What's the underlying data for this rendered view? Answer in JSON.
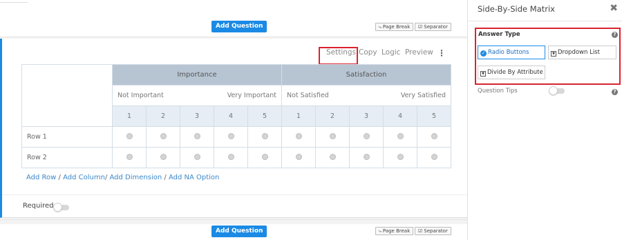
{
  "toolbar_buttons": {
    "add_question": "Add Question",
    "page_break": "Page Break",
    "separator": "Separator"
  },
  "question": {
    "actions": {
      "settings": "Settings",
      "copy": "Copy",
      "logic": "Logic",
      "preview": "Preview",
      "more": "⋮"
    },
    "dimensions": [
      "Importance",
      "Satisfaction"
    ],
    "scale_labels": {
      "importance_low": "Not Important",
      "importance_high": "Very Important",
      "satisfaction_low": "Not Satisfied",
      "satisfaction_high": "Very Satisfied"
    },
    "columns": [
      "1",
      "2",
      "3",
      "4",
      "5",
      "1",
      "2",
      "3",
      "4",
      "5"
    ],
    "rows": [
      "Row 1",
      "Row 2"
    ],
    "add_links": {
      "add_row": "Add Row",
      "add_column": "Add Column",
      "add_dimension": "Add Dimension",
      "add_na": "Add NA Option"
    },
    "required_label": "Required",
    "required_on": false
  },
  "panel": {
    "title": "Side-By-Side Matrix",
    "close": "✖",
    "answer_type_label": "Answer Type",
    "options": {
      "radio": "Radio Buttons",
      "dropdown": "Dropdown List",
      "divide": "Divide By Attribute"
    },
    "selected_option": "Radio Buttons",
    "question_tips_label": "Question Tips",
    "question_tips_on": false,
    "help": "?"
  },
  "colors": {
    "accent": "#1a8ae5",
    "highlight": "#d9232d",
    "header_dim": "#b7c5d3",
    "header_nums": "#e6edf4"
  }
}
